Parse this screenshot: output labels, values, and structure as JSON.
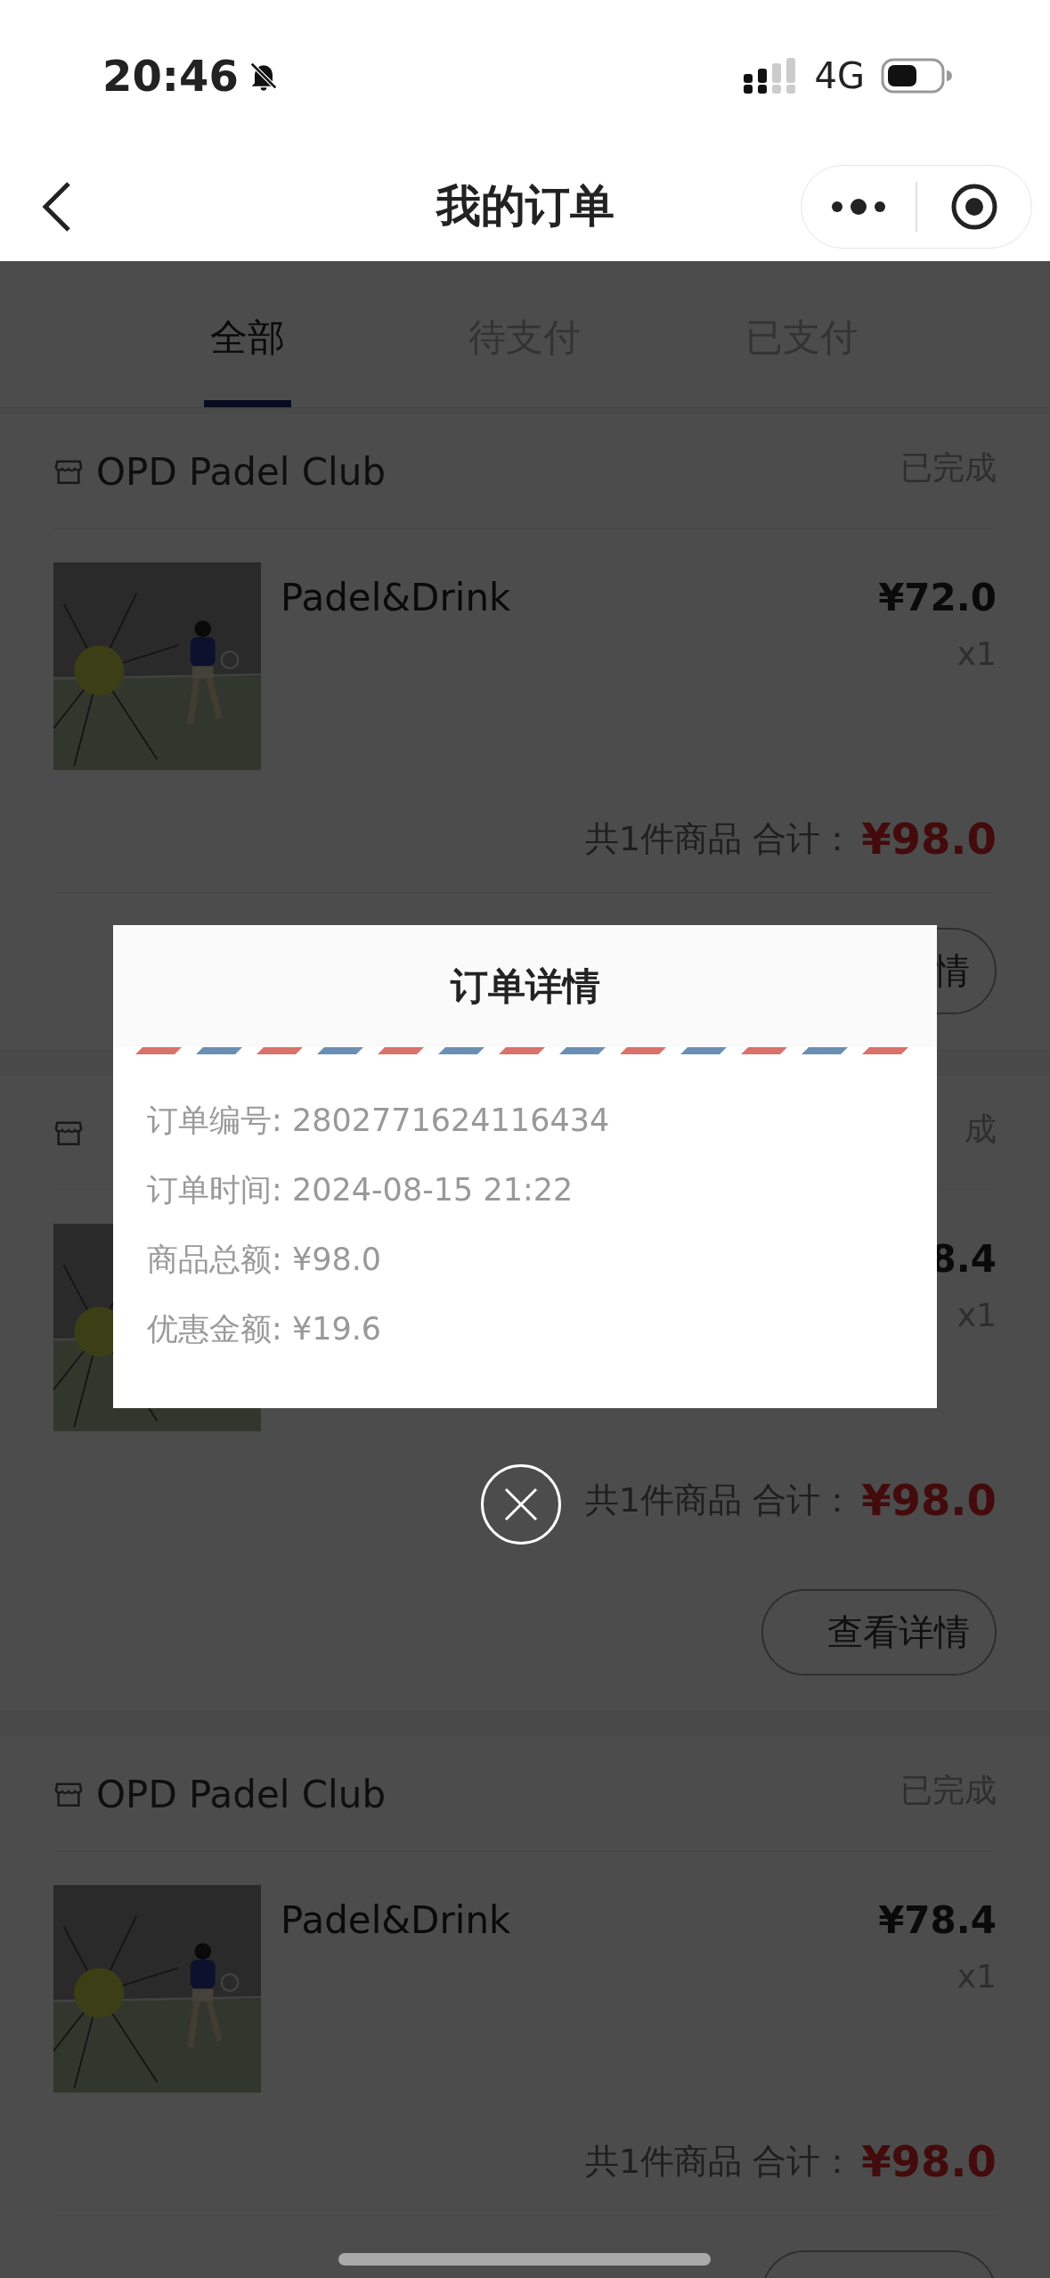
{
  "status_bar": {
    "time": "20:46",
    "network": "4G"
  },
  "nav": {
    "title": "我的订单"
  },
  "tabs": [
    {
      "label": "全部",
      "selected": true
    },
    {
      "label": "待支付",
      "selected": false
    },
    {
      "label": "已支付",
      "selected": false
    }
  ],
  "orders": [
    {
      "shop": "OPD Padel Club",
      "status": "已完成",
      "product": {
        "kind": "picture",
        "name": "Padel&Drink",
        "price": "¥72.0",
        "qty": "x1"
      },
      "summary": "共1件商品 合计：",
      "total": "¥98.0",
      "button": "情"
    },
    {
      "status": "成",
      "product": {
        "kind": "picture",
        "price": "8.4",
        "qty": "x1"
      },
      "summary": "共1件商品 合计：",
      "total": "¥98.0",
      "button": "查看详情"
    },
    {
      "shop": "OPD Padel Club",
      "status": "已完成",
      "product": {
        "kind": "picture",
        "name": "Padel&Drink",
        "price": "¥78.4",
        "qty": "x1"
      },
      "summary": "共1件商品 合计：",
      "total": "¥98.0"
    }
  ],
  "modal": {
    "title": "订单详情",
    "rows": [
      "订单编号: 2802771624116434",
      "订单时间: 2024-08-15 21:22",
      "商品总额: ¥98.0",
      "优惠金额: ¥19.6"
    ]
  }
}
